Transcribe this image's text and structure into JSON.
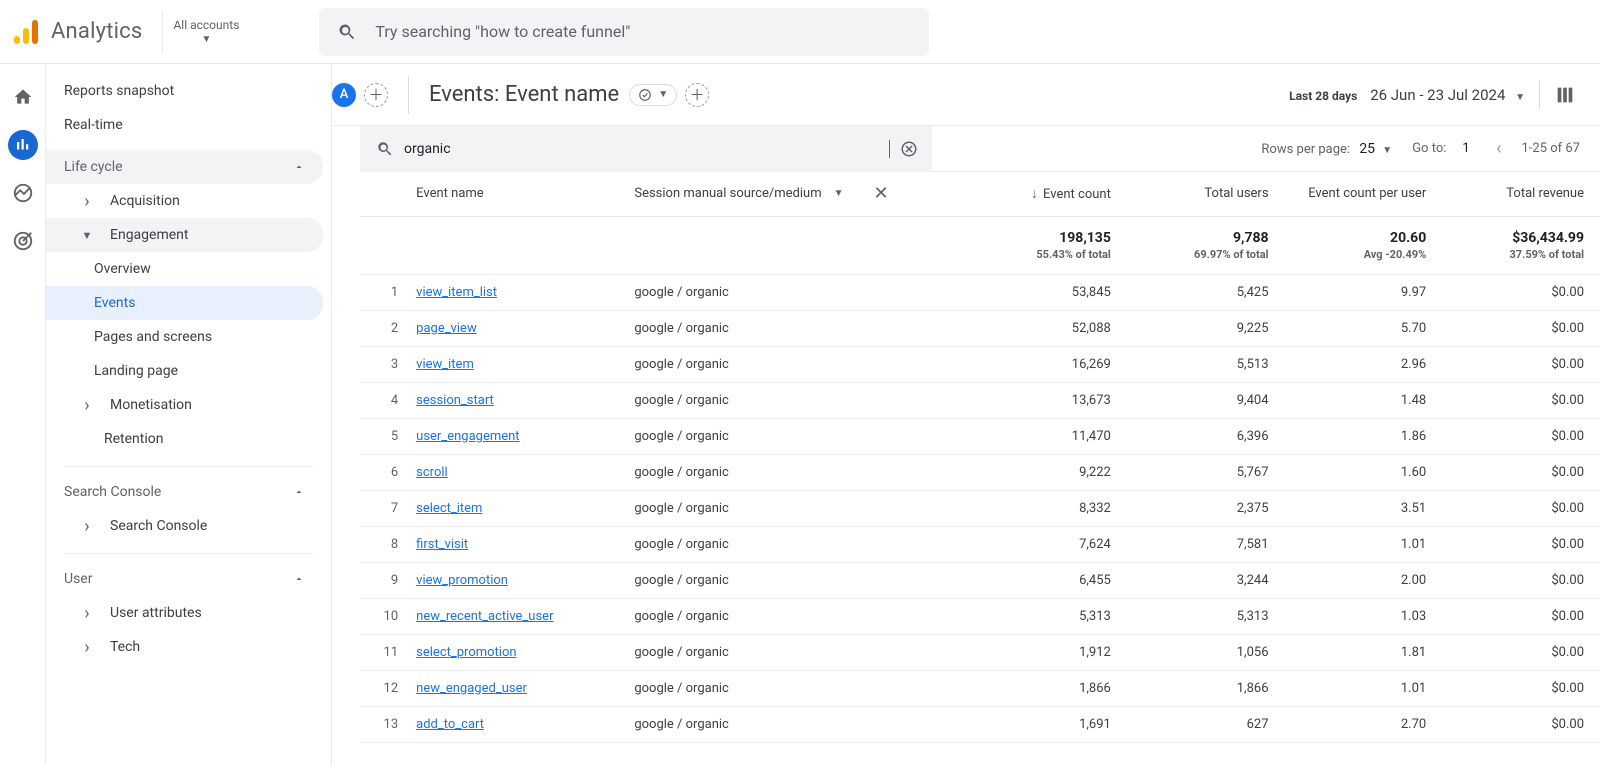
{
  "topbar": {
    "brand": "Analytics",
    "account_picker_label": "All accounts",
    "search_placeholder": "Try searching \"how to create funnel\""
  },
  "sidebar": {
    "reports_snapshot": "Reports snapshot",
    "realtime": "Real-time",
    "section_life_cycle": "Life cycle",
    "acquisition": "Acquisition",
    "engagement": "Engagement",
    "eng_overview": "Overview",
    "eng_events": "Events",
    "eng_pages": "Pages and screens",
    "eng_landing": "Landing page",
    "monetisation": "Monetisation",
    "retention": "Retention",
    "section_search_console": "Search Console",
    "search_console": "Search Console",
    "section_user": "User",
    "user_attributes": "User attributes",
    "tech": "Tech"
  },
  "page_header": {
    "chip_letter": "A",
    "title": "Events: Event name",
    "date_label": "Last 28 days",
    "date_range": "26 Jun - 23 Jul 2024"
  },
  "table_controls": {
    "search_value": "organic",
    "rows_per_page_label": "Rows per page:",
    "rows_per_page_value": "25",
    "goto_label": "Go to:",
    "goto_value": "1",
    "page_range": "1-25 of 67"
  },
  "table_header": {
    "event_name": "Event name",
    "source_medium": "Session manual source/medium",
    "event_count": "Event count",
    "total_users": "Total users",
    "event_count_per_user": "Event count per user",
    "total_revenue": "Total revenue"
  },
  "table_totals": {
    "event_count": "198,135",
    "event_count_sub": "55.43% of total",
    "total_users": "9,788",
    "total_users_sub": "69.97% of total",
    "per_user": "20.60",
    "per_user_sub": "Avg -20.49%",
    "revenue": "$36,434.99",
    "revenue_sub": "37.59% of total"
  },
  "rows": [
    {
      "i": "1",
      "event": "view_item_list",
      "src": "google / organic",
      "count": "53,845",
      "users": "5,425",
      "peruser": "9.97",
      "rev": "$0.00"
    },
    {
      "i": "2",
      "event": "page_view",
      "src": "google / organic",
      "count": "52,088",
      "users": "9,225",
      "peruser": "5.70",
      "rev": "$0.00"
    },
    {
      "i": "3",
      "event": "view_item",
      "src": "google / organic",
      "count": "16,269",
      "users": "5,513",
      "peruser": "2.96",
      "rev": "$0.00"
    },
    {
      "i": "4",
      "event": "session_start",
      "src": "google / organic",
      "count": "13,673",
      "users": "9,404",
      "peruser": "1.48",
      "rev": "$0.00"
    },
    {
      "i": "5",
      "event": "user_engagement",
      "src": "google / organic",
      "count": "11,470",
      "users": "6,396",
      "peruser": "1.86",
      "rev": "$0.00"
    },
    {
      "i": "6",
      "event": "scroll",
      "src": "google / organic",
      "count": "9,222",
      "users": "5,767",
      "peruser": "1.60",
      "rev": "$0.00"
    },
    {
      "i": "7",
      "event": "select_item",
      "src": "google / organic",
      "count": "8,332",
      "users": "2,375",
      "peruser": "3.51",
      "rev": "$0.00"
    },
    {
      "i": "8",
      "event": "first_visit",
      "src": "google / organic",
      "count": "7,624",
      "users": "7,581",
      "peruser": "1.01",
      "rev": "$0.00"
    },
    {
      "i": "9",
      "event": "view_promotion",
      "src": "google / organic",
      "count": "6,455",
      "users": "3,244",
      "peruser": "2.00",
      "rev": "$0.00"
    },
    {
      "i": "10",
      "event": "new_recent_active_user",
      "src": "google / organic",
      "count": "5,313",
      "users": "5,313",
      "peruser": "1.03",
      "rev": "$0.00"
    },
    {
      "i": "11",
      "event": "select_promotion",
      "src": "google / organic",
      "count": "1,912",
      "users": "1,056",
      "peruser": "1.81",
      "rev": "$0.00"
    },
    {
      "i": "12",
      "event": "new_engaged_user",
      "src": "google / organic",
      "count": "1,866",
      "users": "1,866",
      "peruser": "1.01",
      "rev": "$0.00"
    },
    {
      "i": "13",
      "event": "add_to_cart",
      "src": "google / organic",
      "count": "1,691",
      "users": "627",
      "peruser": "2.70",
      "rev": "$0.00"
    }
  ]
}
